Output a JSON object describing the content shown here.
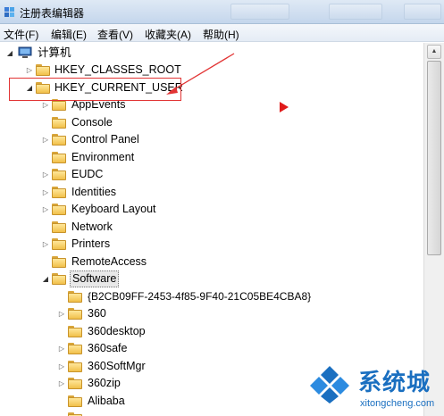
{
  "window": {
    "title": "注册表编辑器"
  },
  "menu": [
    {
      "label": "文件(F)"
    },
    {
      "label": "编辑(E)"
    },
    {
      "label": "查看(V)"
    },
    {
      "label": "收藏夹(A)"
    },
    {
      "label": "帮助(H)"
    }
  ],
  "tree": {
    "root": "计算机",
    "hives": [
      {
        "label": "HKEY_CLASSES_ROOT",
        "expanded": false
      },
      {
        "label": "HKEY_CURRENT_USER",
        "expanded": true
      }
    ],
    "hkcu_children": [
      {
        "label": "AppEvents",
        "has_children": true
      },
      {
        "label": "Console",
        "has_children": false
      },
      {
        "label": "Control Panel",
        "has_children": true
      },
      {
        "label": "Environment",
        "has_children": false
      },
      {
        "label": "EUDC",
        "has_children": true
      },
      {
        "label": "Identities",
        "has_children": true
      },
      {
        "label": "Keyboard Layout",
        "has_children": true
      },
      {
        "label": "Network",
        "has_children": false
      },
      {
        "label": "Printers",
        "has_children": true
      },
      {
        "label": "RemoteAccess",
        "has_children": false
      },
      {
        "label": "Software",
        "has_children": true,
        "expanded": true,
        "selected": true
      }
    ],
    "software_children": [
      {
        "label": "{B2CB09FF-2453-4f85-9F40-21C05BE4CBA8}",
        "has_children": false
      },
      {
        "label": "360",
        "has_children": true
      },
      {
        "label": "360desktop",
        "has_children": false
      },
      {
        "label": "360safe",
        "has_children": true
      },
      {
        "label": "360SoftMgr",
        "has_children": true
      },
      {
        "label": "360zip",
        "has_children": true
      },
      {
        "label": "Alibaba",
        "has_children": false
      }
    ]
  },
  "watermark": {
    "cn": "系统城",
    "en": "xitongcheng.com"
  },
  "colors": {
    "annotation": "#e23434",
    "watermark": "#1a6fc0",
    "folder": "#f1c04a"
  }
}
